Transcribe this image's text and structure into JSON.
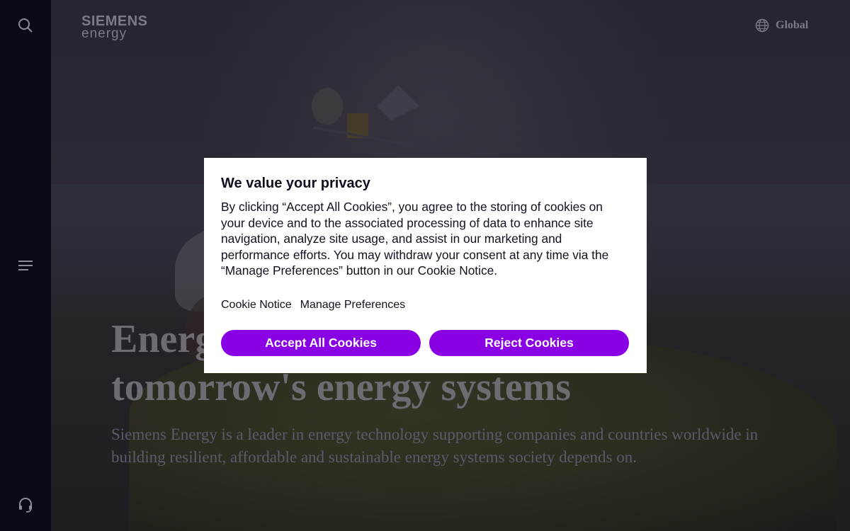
{
  "brand": {
    "line1": "SIEMENS",
    "line2": "energy"
  },
  "header": {
    "region_label": "Global"
  },
  "sidebar": {
    "icons": [
      "search-icon",
      "menu-icon",
      "headset-icon"
    ]
  },
  "hero": {
    "headline_line1": "Energ",
    "headline_line2": "tomorrow's energy systems",
    "subtext": "Siemens Energy is a leader in energy technology supporting companies and countries worldwide in building resilient, affordable and sustainable energy systems society depends on."
  },
  "cookie_modal": {
    "title": "We value your privacy",
    "body": "By clicking “Accept All Cookies”, you agree to the storing of cookies on your device and to the associated processing of data to enhance site navigation, analyze site usage, and assist in our marketing and performance efforts. You may withdraw your consent at any time via the “Manage Preferences” button in our Cookie Notice.",
    "link_cookie_notice": "Cookie Notice",
    "link_manage_preferences": "Manage Preferences",
    "accept_label": "Accept All Cookies",
    "reject_label": "Reject Cookies"
  },
  "colors": {
    "accent": "#8a00e5",
    "sidebar": "#0b0818",
    "modal_bg": "#ffffff",
    "text_dark": "#13101f"
  }
}
